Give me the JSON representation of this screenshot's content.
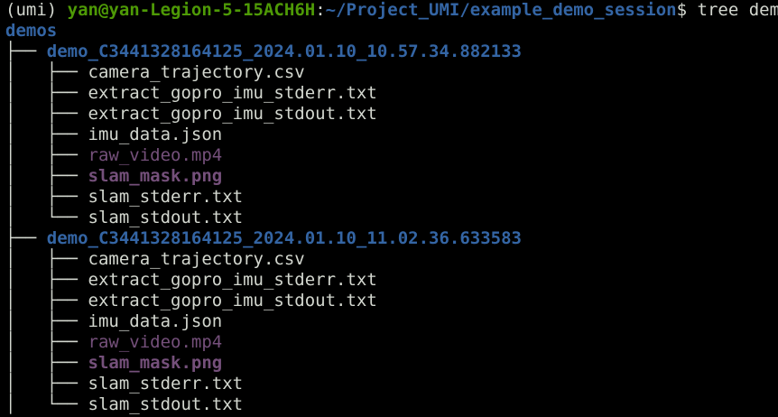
{
  "prompt": {
    "env": "(umi)",
    "user_host": "yan@yan-Legion-5-15ACH6H",
    "sep": ":",
    "path": "~/Project_UMI/example_demo_session",
    "symbol": "$",
    "command": "tree demos"
  },
  "tree": {
    "root": "demos",
    "dirs": [
      {
        "branch": "├── ",
        "name": "demo_C3441328164125_2024.01.10_10.57.34.882133",
        "files": [
          {
            "prefix": "│   ├── ",
            "name": "camera_trajectory.csv",
            "kind": "plain"
          },
          {
            "prefix": "│   ├── ",
            "name": "extract_gopro_imu_stderr.txt",
            "kind": "plain"
          },
          {
            "prefix": "│   ├── ",
            "name": "extract_gopro_imu_stdout.txt",
            "kind": "plain"
          },
          {
            "prefix": "│   ├── ",
            "name": "imu_data.json",
            "kind": "plain"
          },
          {
            "prefix": "│   ├── ",
            "name": "raw_video.mp4",
            "kind": "media"
          },
          {
            "prefix": "│   ├── ",
            "name": "slam_mask.png",
            "kind": "img"
          },
          {
            "prefix": "│   ├── ",
            "name": "slam_stderr.txt",
            "kind": "plain"
          },
          {
            "prefix": "│   └── ",
            "name": "slam_stdout.txt",
            "kind": "plain"
          }
        ]
      },
      {
        "branch": "├── ",
        "name": "demo_C3441328164125_2024.01.10_11.02.36.633583",
        "files": [
          {
            "prefix": "│   ├── ",
            "name": "camera_trajectory.csv",
            "kind": "plain"
          },
          {
            "prefix": "│   ├── ",
            "name": "extract_gopro_imu_stderr.txt",
            "kind": "plain"
          },
          {
            "prefix": "│   ├── ",
            "name": "extract_gopro_imu_stdout.txt",
            "kind": "plain"
          },
          {
            "prefix": "│   ├── ",
            "name": "imu_data.json",
            "kind": "plain"
          },
          {
            "prefix": "│   ├── ",
            "name": "raw_video.mp4",
            "kind": "media"
          },
          {
            "prefix": "│   ├── ",
            "name": "slam_mask.png",
            "kind": "img"
          },
          {
            "prefix": "│   ├── ",
            "name": "slam_stderr.txt",
            "kind": "plain"
          },
          {
            "prefix": "│   └── ",
            "name": "slam_stdout.txt",
            "kind": "plain"
          }
        ]
      }
    ]
  },
  "colors": {
    "background": "#000000",
    "text": "#d3d7cf",
    "directory": "#3465a4",
    "user_host": "#4e9a06",
    "media_file": "#75507b"
  }
}
